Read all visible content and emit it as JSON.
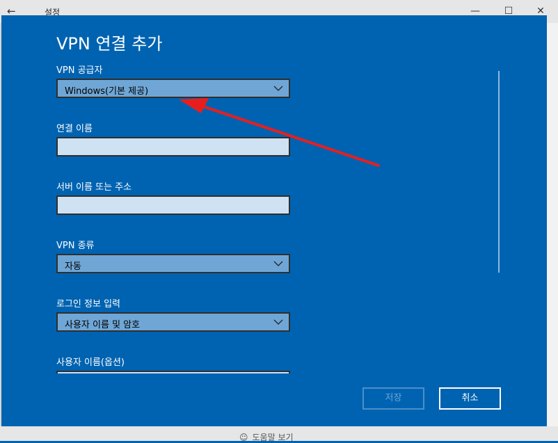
{
  "window": {
    "title": "설정",
    "back_icon": "←",
    "minimize_icon": "—",
    "maximize_icon": "☐",
    "close_icon": "✕",
    "help_text": "도움말 보기",
    "help_icon": "☺"
  },
  "dialog": {
    "title": "VPN 연결 추가",
    "fields": {
      "provider": {
        "label": "VPN 공급자",
        "value": "Windows(기본 제공)"
      },
      "connection_name": {
        "label": "연결 이름",
        "value": ""
      },
      "server": {
        "label": "서버 이름 또는 주소",
        "value": ""
      },
      "vpn_type": {
        "label": "VPN 종류",
        "value": "자동"
      },
      "sign_in": {
        "label": "로그인 정보 입력",
        "value": "사용자 이름 및 암호"
      },
      "username": {
        "label": "사용자 이름(옵션)"
      }
    },
    "buttons": {
      "save": "저장",
      "cancel": "취소"
    }
  },
  "annotation": {
    "color": "#e81e1e"
  },
  "colors": {
    "dialog_bg": "#0063b1",
    "dropdown_bg": "#6fa6d6",
    "textbox_bg": "#cfe2f3"
  }
}
